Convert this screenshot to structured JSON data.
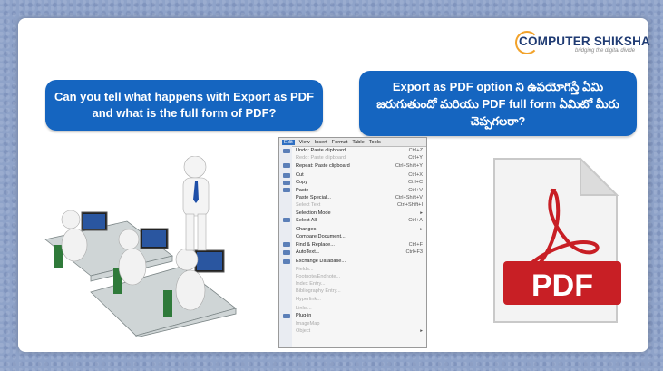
{
  "logo": {
    "text_a": "COMPUTER",
    "text_b": "SHIKSHA",
    "tagline": "bridging the digital divide"
  },
  "question_en": "Can you tell what happens with Export as PDF and what is the full form of PDF?",
  "question_te": "Export as PDF option ని ఉపయోగిస్తే ఏమి జరుగుతుందో మరియు PDF full form ఏమిటో మీరు చెప్పగలరా?",
  "pdf_label": "PDF",
  "menu": {
    "bar": [
      "Edit",
      "View",
      "Insert",
      "Format",
      "Table",
      "Tools"
    ],
    "items": [
      {
        "label": "Undo: Paste clipboard",
        "key": "Ctrl+Z"
      },
      {
        "label": "Redo: Paste clipboard",
        "key": "Ctrl+Y"
      },
      {
        "label": "Repeat: Paste clipboard",
        "key": "Ctrl+Shift+Y"
      },
      {
        "label": "Cut",
        "key": "Ctrl+X"
      },
      {
        "label": "Copy",
        "key": "Ctrl+C"
      },
      {
        "label": "Paste",
        "key": "Ctrl+V"
      },
      {
        "label": "Paste Special...",
        "key": "Ctrl+Shift+V"
      },
      {
        "label": "Select Text",
        "key": "Ctrl+Shift+I"
      },
      {
        "label": "Selection Mode",
        "key": "▸"
      },
      {
        "label": "Select All",
        "key": "Ctrl+A"
      },
      {
        "label": "Changes",
        "key": "▸"
      },
      {
        "label": "Compare Document...",
        "key": ""
      },
      {
        "label": "Find & Replace...",
        "key": "Ctrl+F"
      },
      {
        "label": "AutoText...",
        "key": "Ctrl+F3"
      },
      {
        "label": "Exchange Database...",
        "key": ""
      },
      {
        "label": "Fields...",
        "key": ""
      },
      {
        "label": "Footnote/Endnote...",
        "key": ""
      },
      {
        "label": "Index Entry...",
        "key": ""
      },
      {
        "label": "Bibliography Entry...",
        "key": ""
      },
      {
        "label": "Hyperlink...",
        "key": ""
      },
      {
        "label": "Links...",
        "key": ""
      },
      {
        "label": "Plug-in",
        "key": ""
      },
      {
        "label": "ImageMap",
        "key": ""
      },
      {
        "label": "Object",
        "key": "▸"
      }
    ]
  }
}
